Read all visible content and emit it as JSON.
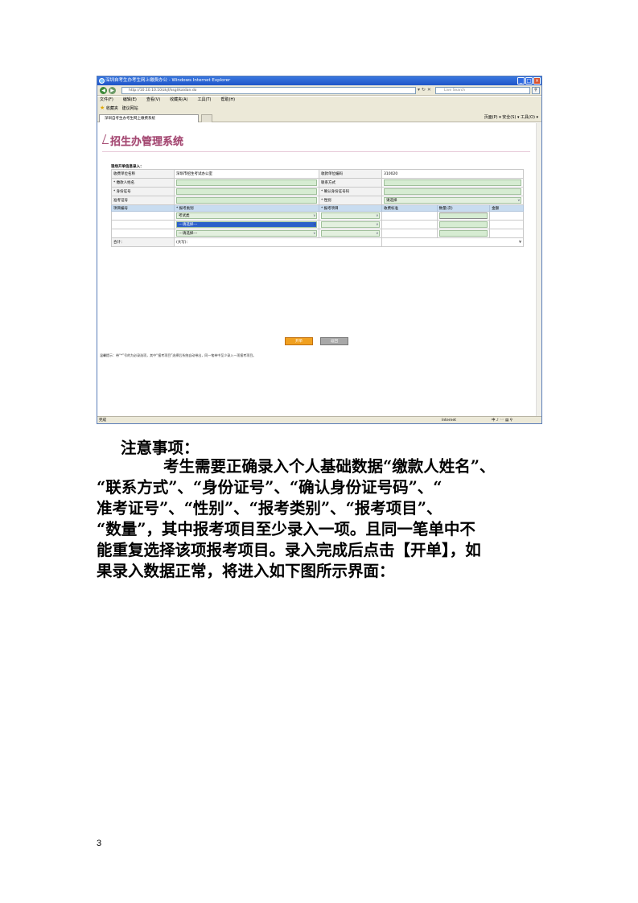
{
  "browser": {
    "window_title": "深圳自考生办考生网上缴费办公 - Windows Internet Explorer",
    "address": "http://10.10.10.10/zkjf/ksgl/kaidan.do",
    "search_placeholder": "Live Search",
    "menu": [
      "文件(F)",
      "编辑(E)",
      "查看(V)",
      "收藏夹(A)",
      "工具(T)",
      "帮助(H)"
    ],
    "favorites_label": "收藏夹",
    "favorites_suggest": "建议网站",
    "tab_title": "深圳自考生办考生网上缴费系统",
    "tab_tools": "页面(P) ▾  安全(S) ▾  工具(O) ▾",
    "status_left": "完成",
    "status_zone": "Internet",
    "status_tray": "中 ♪ ◦◦ ▤ ⚲"
  },
  "system": {
    "title": "招生办管理系统"
  },
  "form": {
    "section_title": "现场开单信息录入：",
    "rows": {
      "org_label": "收费单位名称",
      "org_value": "深圳市招生考试办公室",
      "code_label": "收款单位编码",
      "code_value": "310020",
      "payer_label": "* 缴款人姓名",
      "contact_label": "联系方式",
      "id_label": "* 身份证号",
      "id_confirm_label": "* 确认身份证号码",
      "exam_label": "准考证号",
      "gender_label": "* 性别",
      "category_value": "请选择"
    },
    "item_headers": [
      "项目编号",
      "* 报考类别",
      "* 报考项目",
      "收费标准",
      "数量(次)",
      "金额"
    ],
    "item_rows": [
      {
        "category": "考试类",
        "project": ""
      },
      {
        "category": "---请选择---",
        "project": ""
      },
      {
        "category": "---请选择---",
        "project": ""
      }
    ],
    "total_label": "合计：",
    "total_value": "(大写)：",
    "total_yuan": "¥",
    "btn_open": "开单",
    "btn_back": "返回",
    "hint": "温馨提示：带“*”号的为必录选项，其中“报考项目”选择后系统自动带出，同一笔单中至少录入一项报考项目。"
  },
  "doc": {
    "notice": "注意事项：",
    "lines": [
      "考生需要正确录入个人基础数据“缴款人姓名”、",
      "“联系方式”、“身份证号”、“确认身份证号码”、“",
      "准考证号”、“性别”、“报考类别”、“报考项目”、",
      "“数量”，其中报考项目至少录入一项。且同一笔单中不",
      "能重复选择该项报考项目。录入完成后点击【开单】，如",
      "果录入数据正常，将进入如下图所示界面："
    ],
    "page_number": "3"
  }
}
